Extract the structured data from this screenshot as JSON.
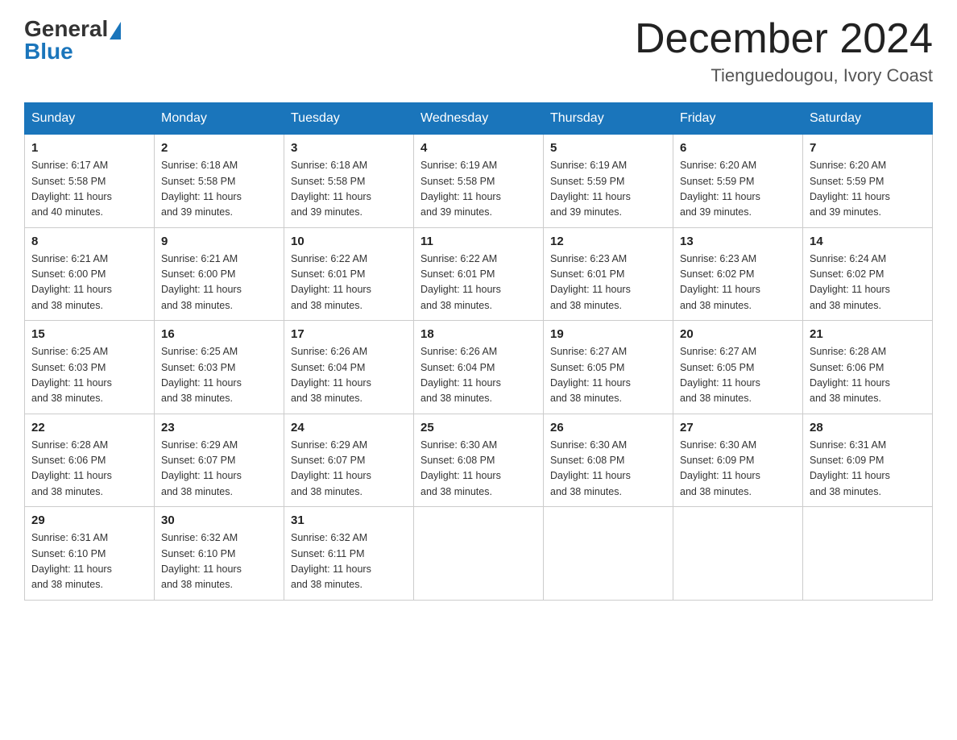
{
  "header": {
    "logo_general": "General",
    "logo_blue": "Blue",
    "month_title": "December 2024",
    "location": "Tienguedougou, Ivory Coast"
  },
  "days_of_week": [
    "Sunday",
    "Monday",
    "Tuesday",
    "Wednesday",
    "Thursday",
    "Friday",
    "Saturday"
  ],
  "weeks": [
    [
      {
        "day": "1",
        "sunrise": "6:17 AM",
        "sunset": "5:58 PM",
        "daylight": "11 hours and 40 minutes."
      },
      {
        "day": "2",
        "sunrise": "6:18 AM",
        "sunset": "5:58 PM",
        "daylight": "11 hours and 39 minutes."
      },
      {
        "day": "3",
        "sunrise": "6:18 AM",
        "sunset": "5:58 PM",
        "daylight": "11 hours and 39 minutes."
      },
      {
        "day": "4",
        "sunrise": "6:19 AM",
        "sunset": "5:58 PM",
        "daylight": "11 hours and 39 minutes."
      },
      {
        "day": "5",
        "sunrise": "6:19 AM",
        "sunset": "5:59 PM",
        "daylight": "11 hours and 39 minutes."
      },
      {
        "day": "6",
        "sunrise": "6:20 AM",
        "sunset": "5:59 PM",
        "daylight": "11 hours and 39 minutes."
      },
      {
        "day": "7",
        "sunrise": "6:20 AM",
        "sunset": "5:59 PM",
        "daylight": "11 hours and 39 minutes."
      }
    ],
    [
      {
        "day": "8",
        "sunrise": "6:21 AM",
        "sunset": "6:00 PM",
        "daylight": "11 hours and 38 minutes."
      },
      {
        "day": "9",
        "sunrise": "6:21 AM",
        "sunset": "6:00 PM",
        "daylight": "11 hours and 38 minutes."
      },
      {
        "day": "10",
        "sunrise": "6:22 AM",
        "sunset": "6:01 PM",
        "daylight": "11 hours and 38 minutes."
      },
      {
        "day": "11",
        "sunrise": "6:22 AM",
        "sunset": "6:01 PM",
        "daylight": "11 hours and 38 minutes."
      },
      {
        "day": "12",
        "sunrise": "6:23 AM",
        "sunset": "6:01 PM",
        "daylight": "11 hours and 38 minutes."
      },
      {
        "day": "13",
        "sunrise": "6:23 AM",
        "sunset": "6:02 PM",
        "daylight": "11 hours and 38 minutes."
      },
      {
        "day": "14",
        "sunrise": "6:24 AM",
        "sunset": "6:02 PM",
        "daylight": "11 hours and 38 minutes."
      }
    ],
    [
      {
        "day": "15",
        "sunrise": "6:25 AM",
        "sunset": "6:03 PM",
        "daylight": "11 hours and 38 minutes."
      },
      {
        "day": "16",
        "sunrise": "6:25 AM",
        "sunset": "6:03 PM",
        "daylight": "11 hours and 38 minutes."
      },
      {
        "day": "17",
        "sunrise": "6:26 AM",
        "sunset": "6:04 PM",
        "daylight": "11 hours and 38 minutes."
      },
      {
        "day": "18",
        "sunrise": "6:26 AM",
        "sunset": "6:04 PM",
        "daylight": "11 hours and 38 minutes."
      },
      {
        "day": "19",
        "sunrise": "6:27 AM",
        "sunset": "6:05 PM",
        "daylight": "11 hours and 38 minutes."
      },
      {
        "day": "20",
        "sunrise": "6:27 AM",
        "sunset": "6:05 PM",
        "daylight": "11 hours and 38 minutes."
      },
      {
        "day": "21",
        "sunrise": "6:28 AM",
        "sunset": "6:06 PM",
        "daylight": "11 hours and 38 minutes."
      }
    ],
    [
      {
        "day": "22",
        "sunrise": "6:28 AM",
        "sunset": "6:06 PM",
        "daylight": "11 hours and 38 minutes."
      },
      {
        "day": "23",
        "sunrise": "6:29 AM",
        "sunset": "6:07 PM",
        "daylight": "11 hours and 38 minutes."
      },
      {
        "day": "24",
        "sunrise": "6:29 AM",
        "sunset": "6:07 PM",
        "daylight": "11 hours and 38 minutes."
      },
      {
        "day": "25",
        "sunrise": "6:30 AM",
        "sunset": "6:08 PM",
        "daylight": "11 hours and 38 minutes."
      },
      {
        "day": "26",
        "sunrise": "6:30 AM",
        "sunset": "6:08 PM",
        "daylight": "11 hours and 38 minutes."
      },
      {
        "day": "27",
        "sunrise": "6:30 AM",
        "sunset": "6:09 PM",
        "daylight": "11 hours and 38 minutes."
      },
      {
        "day": "28",
        "sunrise": "6:31 AM",
        "sunset": "6:09 PM",
        "daylight": "11 hours and 38 minutes."
      }
    ],
    [
      {
        "day": "29",
        "sunrise": "6:31 AM",
        "sunset": "6:10 PM",
        "daylight": "11 hours and 38 minutes."
      },
      {
        "day": "30",
        "sunrise": "6:32 AM",
        "sunset": "6:10 PM",
        "daylight": "11 hours and 38 minutes."
      },
      {
        "day": "31",
        "sunrise": "6:32 AM",
        "sunset": "6:11 PM",
        "daylight": "11 hours and 38 minutes."
      },
      null,
      null,
      null,
      null
    ]
  ],
  "labels": {
    "sunrise": "Sunrise:",
    "sunset": "Sunset:",
    "daylight": "Daylight:"
  }
}
